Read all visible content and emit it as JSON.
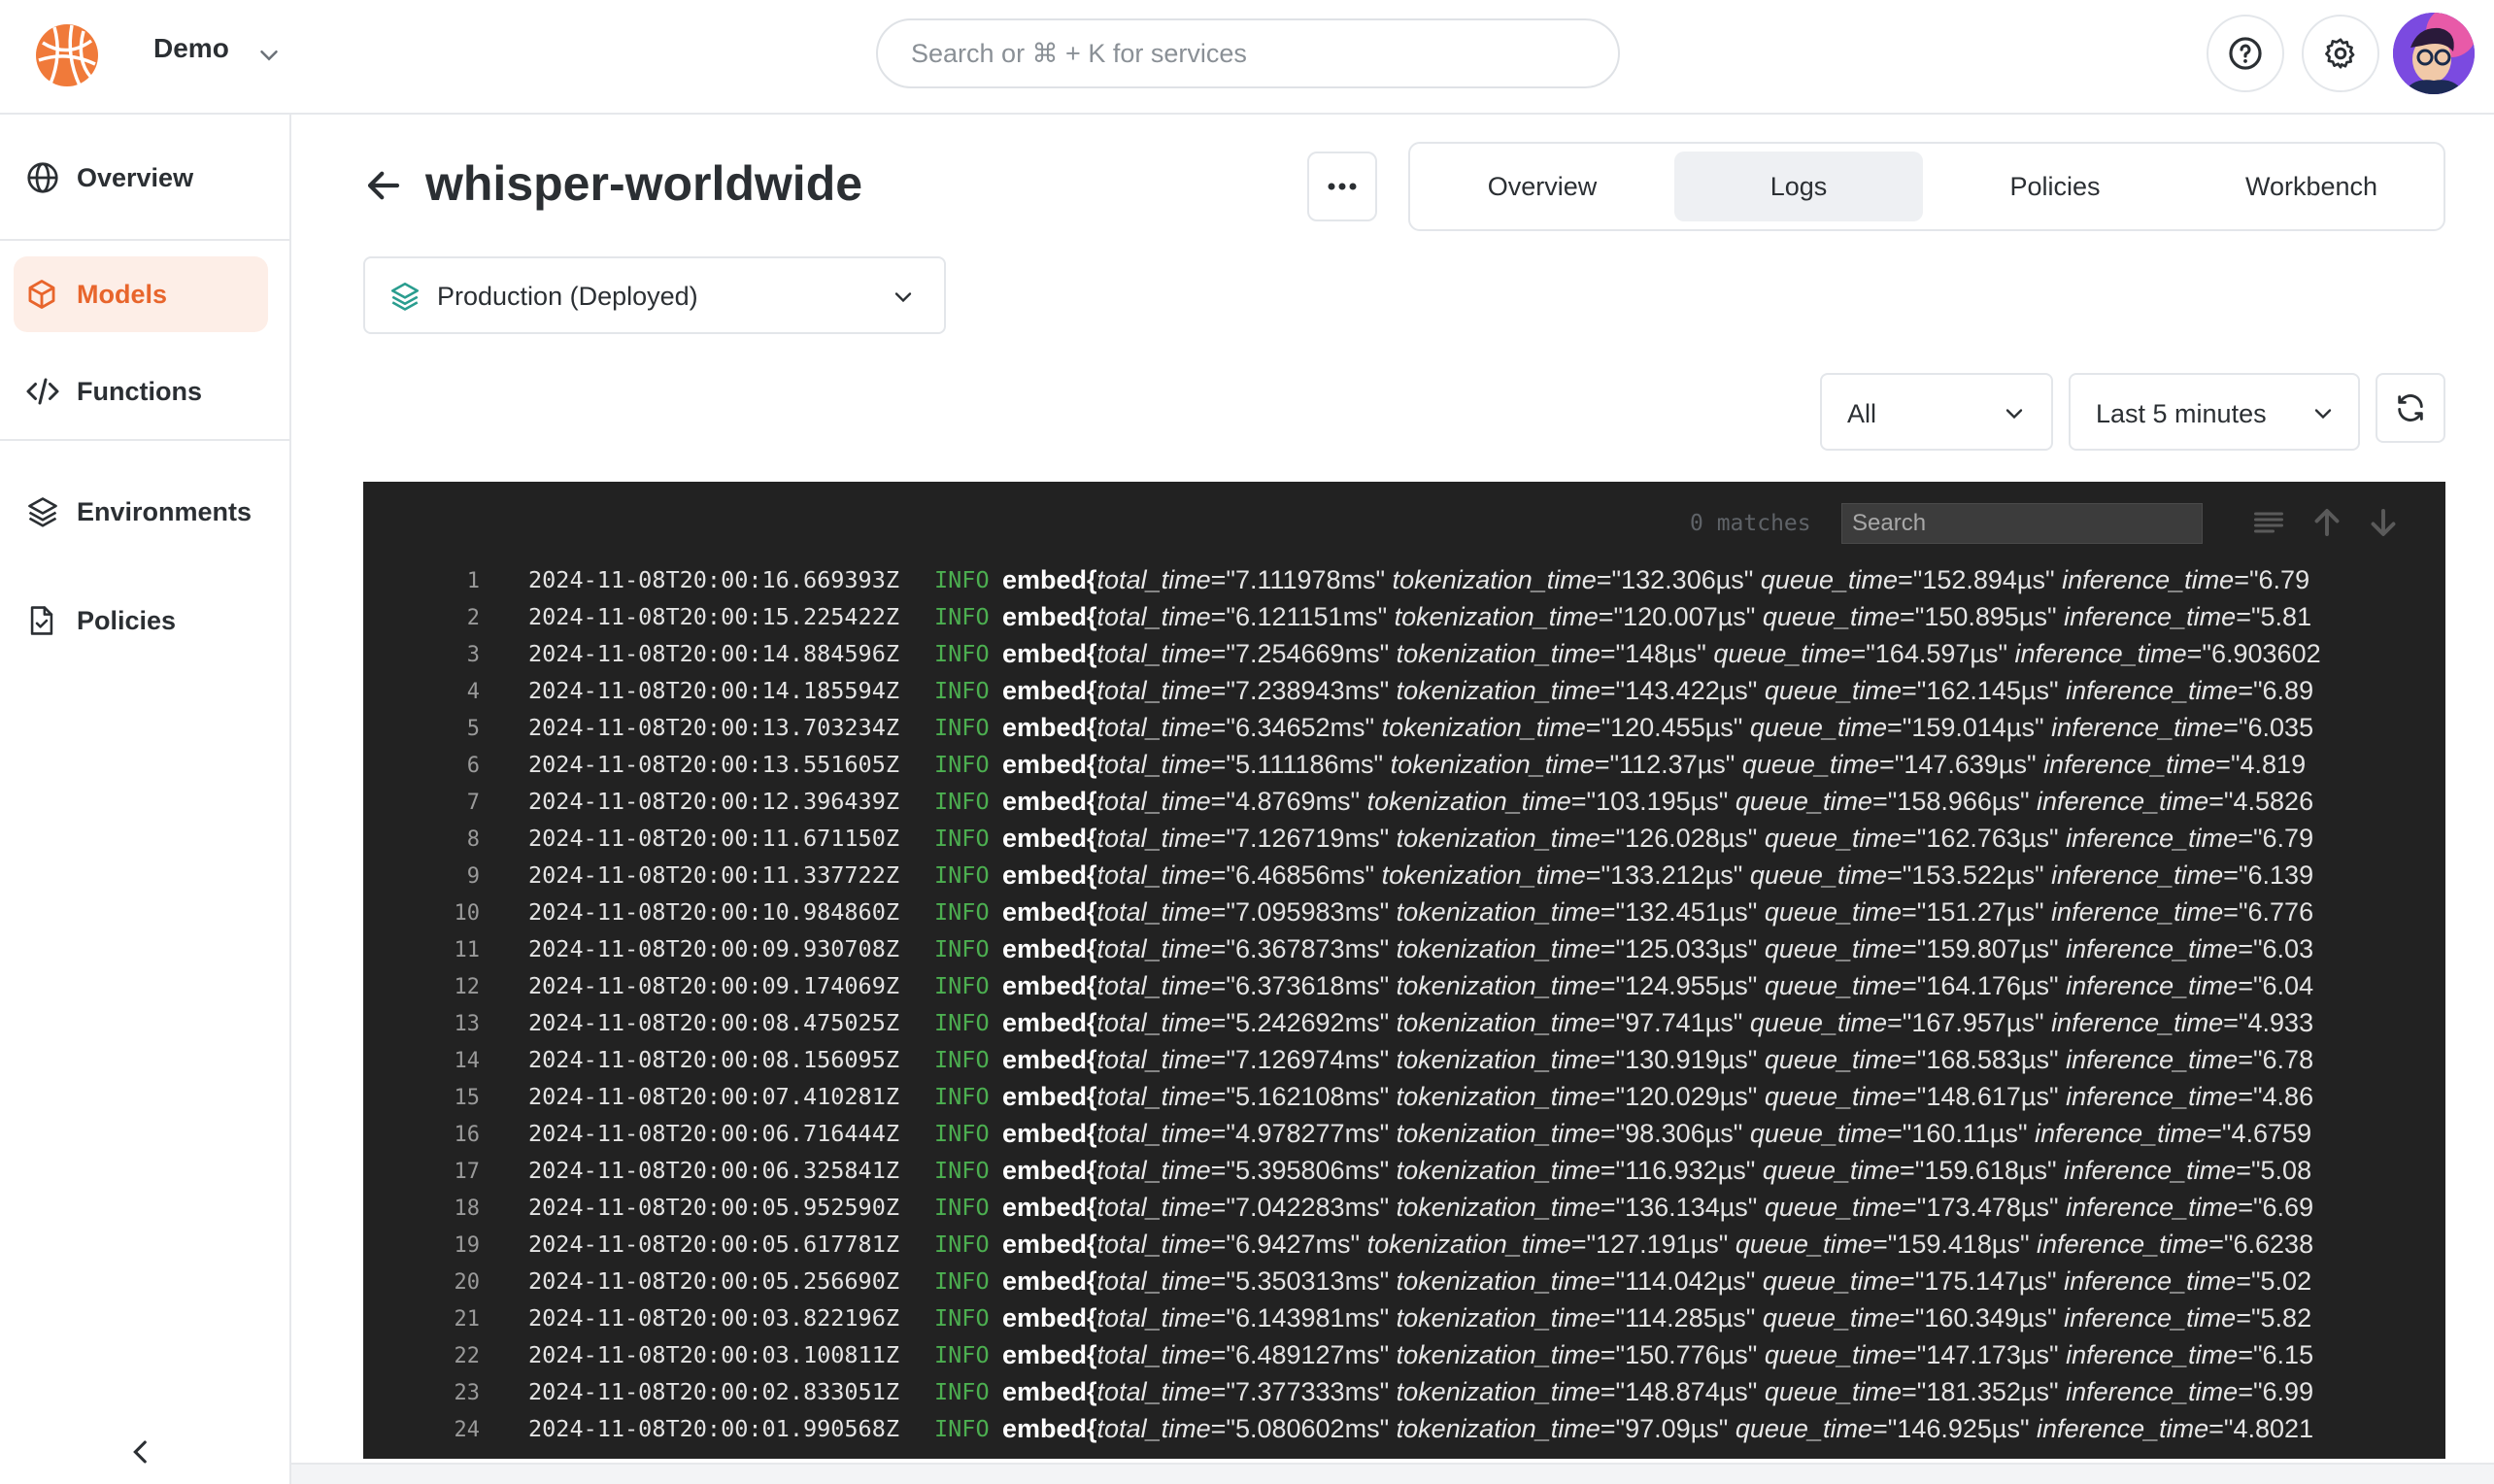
{
  "header": {
    "workspace": "Demo",
    "search_placeholder": "Search or ⌘ + K for services",
    "help_icon": "question-circle-icon",
    "settings_icon": "gear-icon"
  },
  "sidebar": {
    "items": [
      {
        "label": "Overview",
        "icon": "globe-icon"
      },
      {
        "label": "Models",
        "icon": "cube-icon"
      },
      {
        "label": "Functions",
        "icon": "code-icon"
      },
      {
        "label": "Environments",
        "icon": "layers-icon"
      },
      {
        "label": "Policies",
        "icon": "document-check-icon"
      }
    ],
    "active": "Models"
  },
  "page": {
    "title": "whisper-worldwide",
    "tabs": [
      "Overview",
      "Logs",
      "Policies",
      "Workbench"
    ],
    "active_tab": "Logs",
    "environment": "Production (Deployed)",
    "level_filter": "All",
    "time_filter": "Last 5 minutes"
  },
  "logviewer": {
    "matches": "0 matches",
    "search_placeholder": "Search",
    "lines": [
      {
        "n": "1",
        "ts": "2024-11-08T20:00:16.669393Z",
        "level": "INFO",
        "fn": "embed{",
        "total": "\"7.111978ms\"",
        "tok": "\"132.306µs\"",
        "queue": "\"152.894µs\"",
        "inf": "\"6.79"
      },
      {
        "n": "2",
        "ts": "2024-11-08T20:00:15.225422Z",
        "level": "INFO",
        "fn": "embed{",
        "total": "\"6.121151ms\"",
        "tok": "\"120.007µs\"",
        "queue": "\"150.895µs\"",
        "inf": "\"5.81"
      },
      {
        "n": "3",
        "ts": "2024-11-08T20:00:14.884596Z",
        "level": "INFO",
        "fn": "embed{",
        "total": "\"7.254669ms\"",
        "tok": "\"148µs\"",
        "queue": "\"164.597µs\"",
        "inf": "\"6.903602"
      },
      {
        "n": "4",
        "ts": "2024-11-08T20:00:14.185594Z",
        "level": "INFO",
        "fn": "embed{",
        "total": "\"7.238943ms\"",
        "tok": "\"143.422µs\"",
        "queue": "\"162.145µs\"",
        "inf": "\"6.89"
      },
      {
        "n": "5",
        "ts": "2024-11-08T20:00:13.703234Z",
        "level": "INFO",
        "fn": "embed{",
        "total": "\"6.34652ms\"",
        "tok": "\"120.455µs\"",
        "queue": "\"159.014µs\"",
        "inf": "\"6.035"
      },
      {
        "n": "6",
        "ts": "2024-11-08T20:00:13.551605Z",
        "level": "INFO",
        "fn": "embed{",
        "total": "\"5.111186ms\"",
        "tok": "\"112.37µs\"",
        "queue": "\"147.639µs\"",
        "inf": "\"4.819"
      },
      {
        "n": "7",
        "ts": "2024-11-08T20:00:12.396439Z",
        "level": "INFO",
        "fn": "embed{",
        "total": "\"4.8769ms\"",
        "tok": "\"103.195µs\"",
        "queue": "\"158.966µs\"",
        "inf": "\"4.5826"
      },
      {
        "n": "8",
        "ts": "2024-11-08T20:00:11.671150Z",
        "level": "INFO",
        "fn": "embed{",
        "total": "\"7.126719ms\"",
        "tok": "\"126.028µs\"",
        "queue": "\"162.763µs\"",
        "inf": "\"6.79"
      },
      {
        "n": "9",
        "ts": "2024-11-08T20:00:11.337722Z",
        "level": "INFO",
        "fn": "embed{",
        "total": "\"6.46856ms\"",
        "tok": "\"133.212µs\"",
        "queue": "\"153.522µs\"",
        "inf": "\"6.139"
      },
      {
        "n": "10",
        "ts": "2024-11-08T20:00:10.984860Z",
        "level": "INFO",
        "fn": "embed{",
        "total": "\"7.095983ms\"",
        "tok": "\"132.451µs\"",
        "queue": "\"151.27µs\"",
        "inf": "\"6.776"
      },
      {
        "n": "11",
        "ts": "2024-11-08T20:00:09.930708Z",
        "level": "INFO",
        "fn": "embed{",
        "total": "\"6.367873ms\"",
        "tok": "\"125.033µs\"",
        "queue": "\"159.807µs\"",
        "inf": "\"6.03"
      },
      {
        "n": "12",
        "ts": "2024-11-08T20:00:09.174069Z",
        "level": "INFO",
        "fn": "embed{",
        "total": "\"6.373618ms\"",
        "tok": "\"124.955µs\"",
        "queue": "\"164.176µs\"",
        "inf": "\"6.04"
      },
      {
        "n": "13",
        "ts": "2024-11-08T20:00:08.475025Z",
        "level": "INFO",
        "fn": "embed{",
        "total": "\"5.242692ms\"",
        "tok": "\"97.741µs\"",
        "queue": "\"167.957µs\"",
        "inf": "\"4.933"
      },
      {
        "n": "14",
        "ts": "2024-11-08T20:00:08.156095Z",
        "level": "INFO",
        "fn": "embed{",
        "total": "\"7.126974ms\"",
        "tok": "\"130.919µs\"",
        "queue": "\"168.583µs\"",
        "inf": "\"6.78"
      },
      {
        "n": "15",
        "ts": "2024-11-08T20:00:07.410281Z",
        "level": "INFO",
        "fn": "embed{",
        "total": "\"5.162108ms\"",
        "tok": "\"120.029µs\"",
        "queue": "\"148.617µs\"",
        "inf": "\"4.86"
      },
      {
        "n": "16",
        "ts": "2024-11-08T20:00:06.716444Z",
        "level": "INFO",
        "fn": "embed{",
        "total": "\"4.978277ms\"",
        "tok": "\"98.306µs\"",
        "queue": "\"160.11µs\"",
        "inf": "\"4.6759"
      },
      {
        "n": "17",
        "ts": "2024-11-08T20:00:06.325841Z",
        "level": "INFO",
        "fn": "embed{",
        "total": "\"5.395806ms\"",
        "tok": "\"116.932µs\"",
        "queue": "\"159.618µs\"",
        "inf": "\"5.08"
      },
      {
        "n": "18",
        "ts": "2024-11-08T20:00:05.952590Z",
        "level": "INFO",
        "fn": "embed{",
        "total": "\"7.042283ms\"",
        "tok": "\"136.134µs\"",
        "queue": "\"173.478µs\"",
        "inf": "\"6.69"
      },
      {
        "n": "19",
        "ts": "2024-11-08T20:00:05.617781Z",
        "level": "INFO",
        "fn": "embed{",
        "total": "\"6.9427ms\"",
        "tok": "\"127.191µs\"",
        "queue": "\"159.418µs\"",
        "inf": "\"6.6238"
      },
      {
        "n": "20",
        "ts": "2024-11-08T20:00:05.256690Z",
        "level": "INFO",
        "fn": "embed{",
        "total": "\"5.350313ms\"",
        "tok": "\"114.042µs\"",
        "queue": "\"175.147µs\"",
        "inf": "\"5.02"
      },
      {
        "n": "21",
        "ts": "2024-11-08T20:00:03.822196Z",
        "level": "INFO",
        "fn": "embed{",
        "total": "\"6.143981ms\"",
        "tok": "\"114.285µs\"",
        "queue": "\"160.349µs\"",
        "inf": "\"5.82"
      },
      {
        "n": "22",
        "ts": "2024-11-08T20:00:03.100811Z",
        "level": "INFO",
        "fn": "embed{",
        "total": "\"6.489127ms\"",
        "tok": "\"150.776µs\"",
        "queue": "\"147.173µs\"",
        "inf": "\"6.15"
      },
      {
        "n": "23",
        "ts": "2024-11-08T20:00:02.833051Z",
        "level": "INFO",
        "fn": "embed{",
        "total": "\"7.377333ms\"",
        "tok": "\"148.874µs\"",
        "queue": "\"181.352µs\"",
        "inf": "\"6.99"
      },
      {
        "n": "24",
        "ts": "2024-11-08T20:00:01.990568Z",
        "level": "INFO",
        "fn": "embed{",
        "total": "\"5.080602ms\"",
        "tok": "\"97.09µs\"",
        "queue": "\"146.925µs\"",
        "inf": "\"4.8021"
      }
    ]
  },
  "colors": {
    "accent": "#e8652c",
    "accent_bg": "#fdeee7",
    "log_bg": "#222222",
    "info_green": "#4caf50"
  }
}
